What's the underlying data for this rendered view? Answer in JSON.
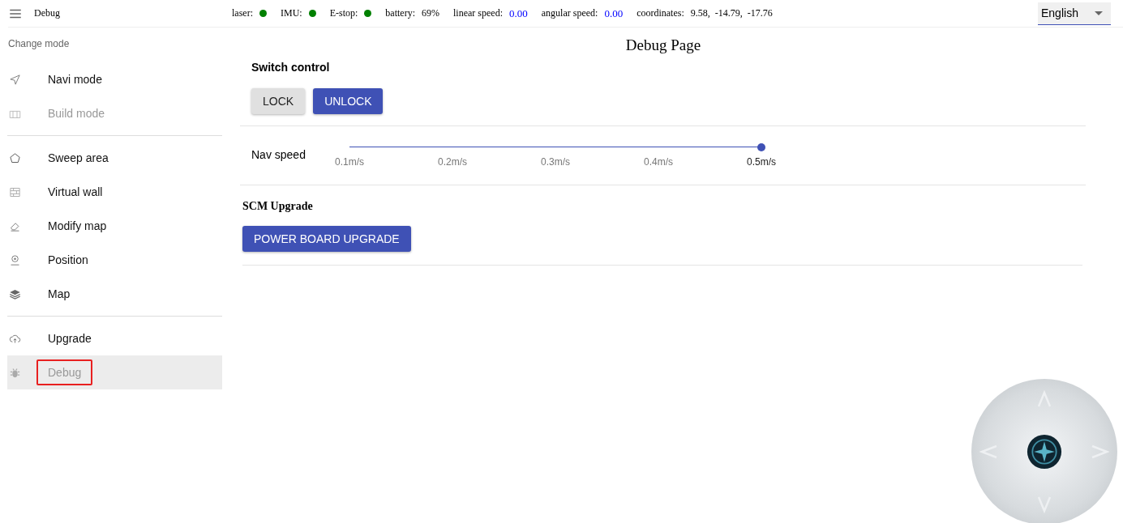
{
  "app_bar": {
    "title": "Debug"
  },
  "status": [
    {
      "kind": "dot",
      "label": "laser:",
      "color": "#008000"
    },
    {
      "kind": "dot",
      "label": "IMU:",
      "color": "#008000"
    },
    {
      "kind": "dot",
      "label": "E-stop:",
      "color": "#008000"
    },
    {
      "kind": "text",
      "label": "battery:",
      "value": "69%"
    },
    {
      "kind": "number",
      "label": "linear speed:",
      "value": "0.00"
    },
    {
      "kind": "number",
      "label": "angular speed:",
      "value": "0.00"
    },
    {
      "kind": "text",
      "label": "coordinates:",
      "value": "9.58,  -14.79,  -17.76"
    }
  ],
  "language": {
    "value": "English"
  },
  "sidebar": {
    "heading": "Change mode",
    "groups": [
      [
        {
          "label": "Navi mode",
          "disabled": false,
          "selected": false,
          "outlined": false
        },
        {
          "label": "Build mode",
          "disabled": true,
          "selected": false,
          "outlined": false
        }
      ],
      [
        {
          "label": "Sweep area",
          "disabled": false,
          "selected": false,
          "outlined": false
        },
        {
          "label": "Virtual wall",
          "disabled": false,
          "selected": false,
          "outlined": false
        },
        {
          "label": "Modify map",
          "disabled": false,
          "selected": false,
          "outlined": false
        },
        {
          "label": "Position",
          "disabled": false,
          "selected": false,
          "outlined": false
        },
        {
          "label": "Map",
          "disabled": false,
          "selected": false,
          "outlined": false
        }
      ],
      [
        {
          "label": "Upgrade",
          "disabled": false,
          "selected": false,
          "outlined": false
        },
        {
          "label": "Debug",
          "disabled": true,
          "selected": true,
          "outlined": true
        }
      ]
    ]
  },
  "page": {
    "title": "Debug Page",
    "switch_control": {
      "heading": "Switch control",
      "buttons": [
        {
          "label": "LOCK",
          "primary": false
        },
        {
          "label": "UNLOCK",
          "primary": true
        }
      ]
    },
    "nav_speed": {
      "label": "Nav speed",
      "level": 1,
      "marks": [
        "0.1m/s",
        "0.2m/s",
        "0.3m/s",
        "0.4m/s",
        "0.5m/s"
      ]
    },
    "scm_upgrade": {
      "heading": "SCM Upgrade",
      "button": "POWER BOARD UPGRADE"
    }
  }
}
